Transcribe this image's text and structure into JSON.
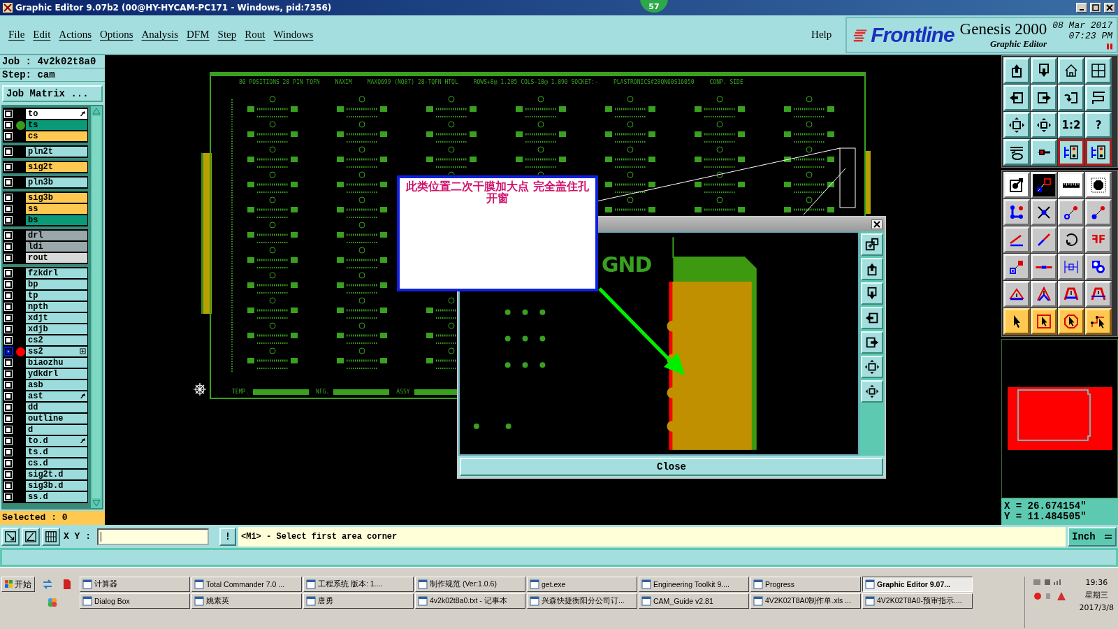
{
  "window": {
    "title": "Graphic Editor 9.07b2 (00@HY-HYCAM-PC171 - Windows, pid:7356)",
    "badge": "57"
  },
  "menu": [
    "File",
    "Edit",
    "Actions",
    "Options",
    "Analysis",
    "DFM",
    "Step",
    "Rout",
    "Windows"
  ],
  "help": "Help",
  "brand": {
    "logo": "Frontline",
    "product": "Genesis 2000",
    "module": "Graphic Editor",
    "date": "08 Mar 2017",
    "time": "07:23 PM"
  },
  "job": {
    "job": "Job : 4v2k02t8a0",
    "step": "Step: cam",
    "matrix_button": "Job Matrix ..."
  },
  "layer_groups": [
    [
      {
        "name": "to",
        "color": "#ffffff",
        "kind": "arrow",
        "selected": false
      },
      {
        "name": "ts",
        "color": "#0a9a78",
        "dot": {
          "color": "#3a9a1a"
        },
        "kind": "plain",
        "selected": false
      },
      {
        "name": "cs",
        "color": "#ffc850",
        "kind": "plain",
        "selected": false
      }
    ],
    [
      {
        "name": "pln2t",
        "color": "#9ddcdc",
        "kind": "plain",
        "selected": false
      }
    ],
    [
      {
        "name": "sig2t",
        "color": "#ffc850",
        "kind": "plain",
        "selected": false
      }
    ],
    [
      {
        "name": "pln3b",
        "color": "#9ddcdc",
        "kind": "plain",
        "selected": false
      }
    ],
    [
      {
        "name": "sig3b",
        "color": "#ffc850",
        "kind": "plain",
        "selected": false
      },
      {
        "name": "ss",
        "color": "#ffc850",
        "kind": "plain",
        "selected": false
      },
      {
        "name": "bs",
        "color": "#0a9a78",
        "kind": "plain",
        "selected": false
      }
    ],
    [
      {
        "name": "drl",
        "color": "#9aa8ac",
        "kind": "plain",
        "selected": false
      },
      {
        "name": "ldi",
        "color": "#9aa8ac",
        "kind": "plain",
        "selected": false
      },
      {
        "name": "rout",
        "color": "#d8d8d8",
        "kind": "plain",
        "selected": false
      }
    ],
    [
      {
        "name": "fzkdrl",
        "color": "#9ddcdc",
        "kind": "plain",
        "selected": false
      },
      {
        "name": "bp",
        "color": "#9ddcdc",
        "kind": "plain",
        "selected": false
      },
      {
        "name": "tp",
        "color": "#9ddcdc",
        "kind": "plain",
        "selected": false
      },
      {
        "name": "npth",
        "color": "#9ddcdc",
        "kind": "plain",
        "selected": false
      },
      {
        "name": "xdjt",
        "color": "#9ddcdc",
        "kind": "plain",
        "selected": false
      },
      {
        "name": "xdjb",
        "color": "#9ddcdc",
        "kind": "plain",
        "selected": false
      },
      {
        "name": "cs2",
        "color": "#9ddcdc",
        "kind": "plain",
        "selected": false
      },
      {
        "name": "ss2",
        "color": "#9ddcdc",
        "dot": {
          "color": "#ff0000"
        },
        "kind": "plus",
        "selected": true
      },
      {
        "name": "biaozhu",
        "color": "#9ddcdc",
        "kind": "plain",
        "selected": false
      },
      {
        "name": "ydkdrl",
        "color": "#9ddcdc",
        "kind": "plain",
        "selected": false
      },
      {
        "name": "asb",
        "color": "#9ddcdc",
        "kind": "plain",
        "selected": false
      },
      {
        "name": "ast",
        "color": "#9ddcdc",
        "kind": "arrow",
        "selected": false
      },
      {
        "name": "dd",
        "color": "#9ddcdc",
        "kind": "plain",
        "selected": false
      },
      {
        "name": "outline",
        "color": "#9ddcdc",
        "kind": "plain",
        "selected": false
      },
      {
        "name": "d",
        "color": "#9ddcdc",
        "kind": "plain",
        "selected": false
      },
      {
        "name": "to.d",
        "color": "#9ddcdc",
        "kind": "arrow",
        "selected": false
      },
      {
        "name": "ts.d",
        "color": "#9ddcdc",
        "kind": "plain",
        "selected": false
      },
      {
        "name": "cs.d",
        "color": "#9ddcdc",
        "kind": "plain",
        "selected": false
      },
      {
        "name": "sig2t.d",
        "color": "#9ddcdc",
        "kind": "plain",
        "selected": false
      },
      {
        "name": "sig3b.d",
        "color": "#9ddcdc",
        "kind": "plain",
        "selected": false
      },
      {
        "name": "ss.d",
        "color": "#9ddcdc",
        "kind": "plain",
        "selected": false
      }
    ]
  ],
  "selected_count": "Selected : 0",
  "board": {
    "header": [
      "80 POSITIONS 28 PIN TQFN",
      "NAXIM",
      "MAXQ699 (NQ87) 28-TQFN HTQL",
      "ROWS+8@ 1.285 COLS-10@ 1.890 SOCKET:-",
      "PLASTRONICS#28QN60S16050",
      "CONP. SIDE"
    ],
    "footer": [
      "TEMP.",
      "NFG.",
      "ASSY"
    ]
  },
  "note": {
    "text": "此类位置二次干膜加大点 完全盖住孔开窗"
  },
  "zoom_window": {
    "label": "GND",
    "close": "Close",
    "tools": [
      {
        "kind": "expand"
      },
      {
        "kind": "up"
      },
      {
        "kind": "down"
      },
      {
        "kind": "left"
      },
      {
        "kind": "right"
      },
      {
        "kind": "fit"
      },
      {
        "kind": "center"
      }
    ]
  },
  "tool_groups": [
    {
      "kind": "view",
      "tools": [
        {
          "kind": "up",
          "selected": false
        },
        {
          "kind": "down",
          "selected": false
        },
        {
          "kind": "home",
          "selected": false
        },
        {
          "kind": "grid",
          "selected": false
        },
        {
          "kind": "left",
          "selected": false
        },
        {
          "kind": "right",
          "selected": false
        },
        {
          "kind": "undo",
          "selected": false
        },
        {
          "kind": "snake",
          "selected": false
        },
        {
          "kind": "fit",
          "selected": false
        },
        {
          "kind": "center",
          "selected": false
        },
        {
          "kind": "text",
          "label": "1:2",
          "selected": false
        },
        {
          "kind": "text",
          "label": "?",
          "selected": false
        },
        {
          "kind": "tools",
          "selected": false
        },
        {
          "kind": "probe",
          "selected": false
        },
        {
          "kind": "traffic",
          "selected": true
        },
        {
          "kind": "traffic",
          "selected": true
        }
      ]
    },
    {
      "kind": "edit",
      "tools": [
        {
          "kind": "pad",
          "selected": false
        },
        {
          "kind": "measure",
          "selected": false
        },
        {
          "kind": "ruler",
          "selected": false
        },
        {
          "kind": "octagon",
          "selected": false
        },
        {
          "kind": "nodes",
          "selected": false
        },
        {
          "kind": "cross",
          "selected": false
        },
        {
          "kind": "moveo",
          "selected": false
        },
        {
          "kind": "movep",
          "selected": false
        },
        {
          "kind": "angle",
          "selected": false
        },
        {
          "kind": "slash",
          "selected": false
        },
        {
          "kind": "rotate",
          "selected": false
        },
        {
          "kind": "text",
          "label": "ꟻF",
          "selected": false
        },
        {
          "kind": "padsq",
          "selected": false
        },
        {
          "kind": "mid",
          "selected": false
        },
        {
          "kind": "dim",
          "selected": false
        },
        {
          "kind": "blobs",
          "selected": false
        },
        {
          "kind": "tri",
          "selected": false
        },
        {
          "kind": "tri2",
          "selected": false
        },
        {
          "kind": "trap",
          "selected": false
        },
        {
          "kind": "trap2",
          "selected": false
        },
        {
          "kind": "ptr",
          "selected": false
        },
        {
          "kind": "ptrbox",
          "selected": false
        },
        {
          "kind": "ptroct",
          "selected": false
        },
        {
          "kind": "ptrroute",
          "selected": false
        }
      ]
    }
  ],
  "coords": {
    "x": "X = 26.674154\"",
    "y": "Y = 11.484505\""
  },
  "command": {
    "xy_label": "X Y :",
    "bang": "!",
    "prompt": "<M1> - Select first area corner",
    "units": "Inch"
  },
  "taskbar": {
    "start": "开始",
    "rows": [
      [
        {
          "label": "计算器",
          "selected": false
        },
        {
          "label": "Total Commander 7.0 ...",
          "selected": false
        },
        {
          "label": "工程系统  版本: 1....",
          "selected": false
        },
        {
          "label": "制作规范 (Ver:1.0.6)",
          "selected": false
        },
        {
          "label": "get.exe",
          "selected": false
        },
        {
          "label": "Engineering Toolkit 9....",
          "selected": false
        },
        {
          "label": "Progress",
          "selected": false
        },
        {
          "label": "Graphic Editor 9.07...",
          "selected": true
        }
      ],
      [
        {
          "label": "Dialog Box",
          "selected": false
        },
        {
          "label": "姚素英",
          "selected": false
        },
        {
          "label": "唐勇",
          "selected": false
        },
        {
          "label": "4v2k02t8a0.txt - 记事本",
          "selected": false
        },
        {
          "label": "兴森快捷衡阳分公司订...",
          "selected": false
        },
        {
          "label": "CAM_Guide v2.81",
          "selected": false
        },
        {
          "label": "4V2K02T8A0制作单.xls ...",
          "selected": false
        },
        {
          "label": "4V2K02T8A0-预审指示....",
          "selected": false
        }
      ]
    ],
    "time": "19:36",
    "weekday": "星期三",
    "date": "2017/3/8"
  }
}
